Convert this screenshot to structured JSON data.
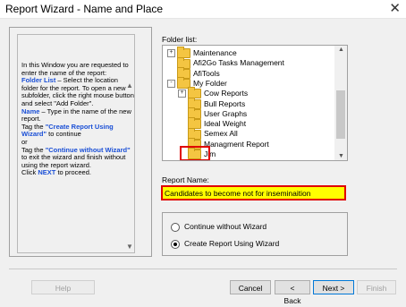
{
  "window": {
    "title": "Report Wizard - Name and Place",
    "close_glyph": "✕"
  },
  "help": {
    "parts": [
      {
        "text": "In this Window you are requested to enter the name of the report:",
        "style": "plain"
      },
      {
        "text": "Folder List",
        "style": "blue"
      },
      {
        "text": " – Select the location folder for the report. To open a new subfolder, click the right mouse button and select \"Add Folder\".",
        "style": "plain"
      },
      {
        "text": "Name",
        "style": "blue"
      },
      {
        "text": " – Type in the name of the new report.",
        "style": "plain"
      },
      {
        "text": "Tag the ",
        "style": "plain"
      },
      {
        "text": "\"Create Report Using Wizard\"",
        "style": "blue"
      },
      {
        "text": " to continue",
        "style": "plain"
      },
      {
        "text": "or",
        "style": "plain"
      },
      {
        "text": "Tag the ",
        "style": "plain"
      },
      {
        "text": "\"Continue without Wizard\"",
        "style": "blue"
      },
      {
        "text": " to exit the wizard and finish without using the report wizard.",
        "style": "plain"
      },
      {
        "text": "Click ",
        "style": "plain"
      },
      {
        "text": "NEXT",
        "style": "blue"
      },
      {
        "text": " to proceed.",
        "style": "plain"
      }
    ]
  },
  "folder_list": {
    "label": "Folder list:",
    "items": [
      {
        "label": "Maintenance",
        "expander": "+",
        "level": 0
      },
      {
        "label": "Afi2Go Tasks Management",
        "expander": "",
        "level": 0
      },
      {
        "label": "AfiTools",
        "expander": "",
        "level": 0
      },
      {
        "label": "My Folder",
        "expander": "-",
        "level": 0
      },
      {
        "label": "Cow Reports",
        "expander": "+",
        "level": 1
      },
      {
        "label": "Bull Reports",
        "expander": "",
        "level": 1
      },
      {
        "label": "User Graphs",
        "expander": "",
        "level": 1
      },
      {
        "label": "Ideal Weight",
        "expander": "",
        "level": 1
      },
      {
        "label": "Semex All",
        "expander": "",
        "level": 1
      },
      {
        "label": "Managment Report",
        "expander": "",
        "level": 1
      },
      {
        "label": "Jim",
        "expander": "",
        "level": 1,
        "selected": true
      }
    ]
  },
  "report_name": {
    "label": "Report Name:",
    "value": "Candidates to become not for inseminaition"
  },
  "wizard_options": [
    {
      "label": "Continue without Wizard",
      "checked": false
    },
    {
      "label": "Create Report Using Wizard",
      "checked": true
    }
  ],
  "buttons": {
    "help": "Help",
    "cancel": "Cancel",
    "back": "< Back",
    "next": "Next >",
    "finish": "Finish"
  },
  "colors": {
    "help_blue": "#1a4fd6",
    "highlight_red": "#e00000",
    "input_yellow": "#ffff00"
  }
}
